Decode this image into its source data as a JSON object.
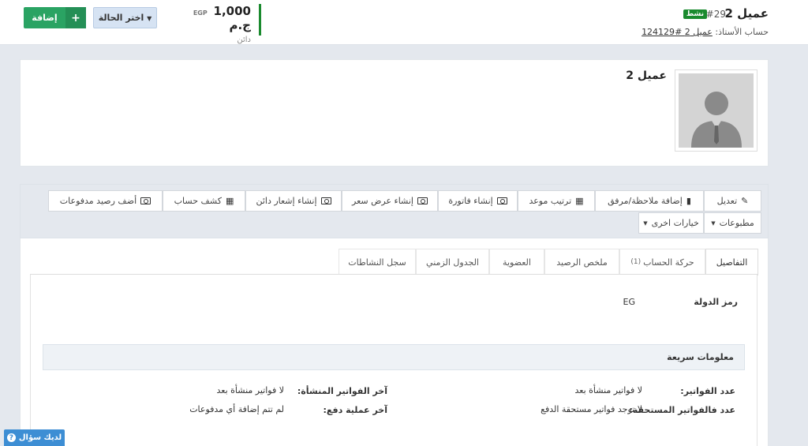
{
  "header": {
    "client_name": "عميل 2",
    "client_number": "#29",
    "status": "نشط",
    "account_prefix": "حساب الأستاذ:",
    "account_link": "عميل 2 #124129",
    "balance_amount": "1,000 ج.م",
    "balance_currency": "EGP",
    "balance_type": "دائن",
    "status_select_label": "اختر الحالة",
    "add_label": "إضافة"
  },
  "profile": {
    "name": "عميل 2"
  },
  "toolbar": {
    "edit": "تعديل",
    "add_note": "إضافة ملاحظة/مرفق",
    "schedule": "ترتيب موعد",
    "create_invoice": "إنشاء فاتورة",
    "create_quote": "إنشاء عرض سعر",
    "create_credit_note": "إنشاء إشعار دائن",
    "statement": "كشف حساب",
    "add_payment_balance": "أضف رصيد مدفوعات",
    "prints": "مطبوعات",
    "other_options": "خيارات اخرى"
  },
  "tabs": {
    "details": "التفاصيل",
    "account_movement": "حركة الحساب",
    "account_movement_count": "(1)",
    "balance_summary": "ملخص الرصيد",
    "membership": "العضوية",
    "timeline": "الجدول الزمني",
    "activity_log": "سجل النشاطات"
  },
  "details": {
    "country_code_label": "رمز الدولة",
    "country_code_value": "EG"
  },
  "quick_info": {
    "title": "معلومات سريعة",
    "invoice_count_label": "عدد الفواتير:",
    "invoice_count_value": "لا فواتير منشأة بعد",
    "last_invoices_label": "آخر الفواتير المنشأة:",
    "last_invoices_value": "لا فواتير منشأة بعد",
    "due_invoices_label": "عدد فالفواتير المستحقة:",
    "due_invoices_value": "لا توجد فواتير مستحقة الدفع",
    "last_payment_label": "آخر عملية دفع:",
    "last_payment_value": "لم تتم إضافة أي مدفوعات"
  },
  "help": {
    "label": "لديك سؤال"
  }
}
